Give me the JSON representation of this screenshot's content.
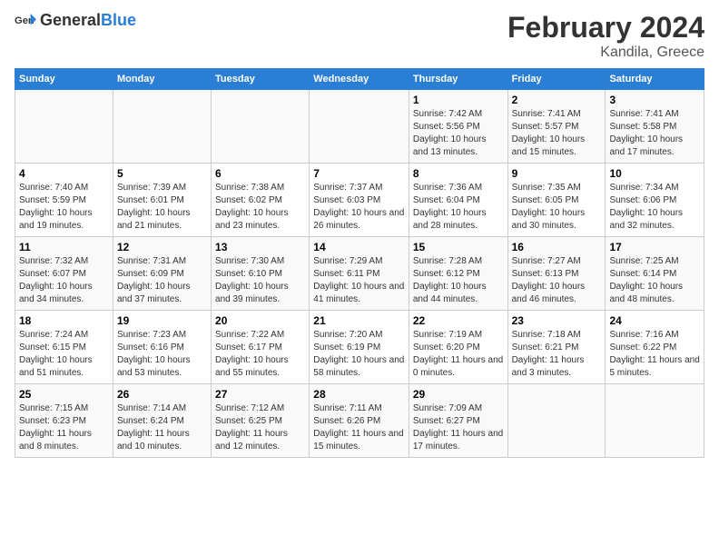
{
  "app": {
    "logo_general": "General",
    "logo_blue": "Blue",
    "title": "February 2024",
    "location": "Kandila, Greece"
  },
  "calendar": {
    "headers": [
      "Sunday",
      "Monday",
      "Tuesday",
      "Wednesday",
      "Thursday",
      "Friday",
      "Saturday"
    ],
    "rows": [
      [
        {
          "day": "",
          "content": ""
        },
        {
          "day": "",
          "content": ""
        },
        {
          "day": "",
          "content": ""
        },
        {
          "day": "",
          "content": ""
        },
        {
          "day": "1",
          "content": "Sunrise: 7:42 AM\nSunset: 5:56 PM\nDaylight: 10 hours\nand 13 minutes."
        },
        {
          "day": "2",
          "content": "Sunrise: 7:41 AM\nSunset: 5:57 PM\nDaylight: 10 hours\nand 15 minutes."
        },
        {
          "day": "3",
          "content": "Sunrise: 7:41 AM\nSunset: 5:58 PM\nDaylight: 10 hours\nand 17 minutes."
        }
      ],
      [
        {
          "day": "4",
          "content": "Sunrise: 7:40 AM\nSunset: 5:59 PM\nDaylight: 10 hours\nand 19 minutes."
        },
        {
          "day": "5",
          "content": "Sunrise: 7:39 AM\nSunset: 6:01 PM\nDaylight: 10 hours\nand 21 minutes."
        },
        {
          "day": "6",
          "content": "Sunrise: 7:38 AM\nSunset: 6:02 PM\nDaylight: 10 hours\nand 23 minutes."
        },
        {
          "day": "7",
          "content": "Sunrise: 7:37 AM\nSunset: 6:03 PM\nDaylight: 10 hours\nand 26 minutes."
        },
        {
          "day": "8",
          "content": "Sunrise: 7:36 AM\nSunset: 6:04 PM\nDaylight: 10 hours\nand 28 minutes."
        },
        {
          "day": "9",
          "content": "Sunrise: 7:35 AM\nSunset: 6:05 PM\nDaylight: 10 hours\nand 30 minutes."
        },
        {
          "day": "10",
          "content": "Sunrise: 7:34 AM\nSunset: 6:06 PM\nDaylight: 10 hours\nand 32 minutes."
        }
      ],
      [
        {
          "day": "11",
          "content": "Sunrise: 7:32 AM\nSunset: 6:07 PM\nDaylight: 10 hours\nand 34 minutes."
        },
        {
          "day": "12",
          "content": "Sunrise: 7:31 AM\nSunset: 6:09 PM\nDaylight: 10 hours\nand 37 minutes."
        },
        {
          "day": "13",
          "content": "Sunrise: 7:30 AM\nSunset: 6:10 PM\nDaylight: 10 hours\nand 39 minutes."
        },
        {
          "day": "14",
          "content": "Sunrise: 7:29 AM\nSunset: 6:11 PM\nDaylight: 10 hours\nand 41 minutes."
        },
        {
          "day": "15",
          "content": "Sunrise: 7:28 AM\nSunset: 6:12 PM\nDaylight: 10 hours\nand 44 minutes."
        },
        {
          "day": "16",
          "content": "Sunrise: 7:27 AM\nSunset: 6:13 PM\nDaylight: 10 hours\nand 46 minutes."
        },
        {
          "day": "17",
          "content": "Sunrise: 7:25 AM\nSunset: 6:14 PM\nDaylight: 10 hours\nand 48 minutes."
        }
      ],
      [
        {
          "day": "18",
          "content": "Sunrise: 7:24 AM\nSunset: 6:15 PM\nDaylight: 10 hours\nand 51 minutes."
        },
        {
          "day": "19",
          "content": "Sunrise: 7:23 AM\nSunset: 6:16 PM\nDaylight: 10 hours\nand 53 minutes."
        },
        {
          "day": "20",
          "content": "Sunrise: 7:22 AM\nSunset: 6:17 PM\nDaylight: 10 hours\nand 55 minutes."
        },
        {
          "day": "21",
          "content": "Sunrise: 7:20 AM\nSunset: 6:19 PM\nDaylight: 10 hours\nand 58 minutes."
        },
        {
          "day": "22",
          "content": "Sunrise: 7:19 AM\nSunset: 6:20 PM\nDaylight: 11 hours\nand 0 minutes."
        },
        {
          "day": "23",
          "content": "Sunrise: 7:18 AM\nSunset: 6:21 PM\nDaylight: 11 hours\nand 3 minutes."
        },
        {
          "day": "24",
          "content": "Sunrise: 7:16 AM\nSunset: 6:22 PM\nDaylight: 11 hours\nand 5 minutes."
        }
      ],
      [
        {
          "day": "25",
          "content": "Sunrise: 7:15 AM\nSunset: 6:23 PM\nDaylight: 11 hours\nand 8 minutes."
        },
        {
          "day": "26",
          "content": "Sunrise: 7:14 AM\nSunset: 6:24 PM\nDaylight: 11 hours\nand 10 minutes."
        },
        {
          "day": "27",
          "content": "Sunrise: 7:12 AM\nSunset: 6:25 PM\nDaylight: 11 hours\nand 12 minutes."
        },
        {
          "day": "28",
          "content": "Sunrise: 7:11 AM\nSunset: 6:26 PM\nDaylight: 11 hours\nand 15 minutes."
        },
        {
          "day": "29",
          "content": "Sunrise: 7:09 AM\nSunset: 6:27 PM\nDaylight: 11 hours\nand 17 minutes."
        },
        {
          "day": "",
          "content": ""
        },
        {
          "day": "",
          "content": ""
        }
      ]
    ]
  }
}
